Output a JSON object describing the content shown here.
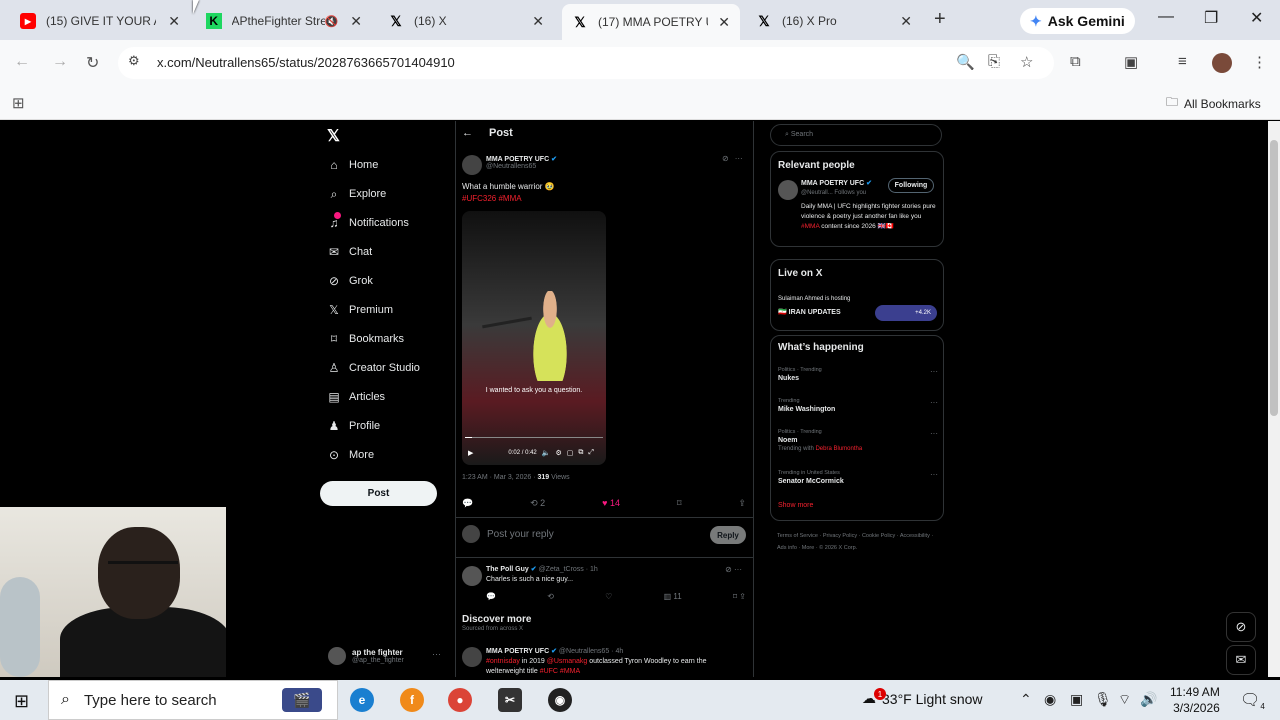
{
  "browser": {
    "tabs": [
      {
        "title": "(15) GIVE IT YOUR AL",
        "icon": "youtube-icon",
        "active": false
      },
      {
        "title": "APtheFighter Stre",
        "icon": "kick-icon",
        "active": false
      },
      {
        "title": "(16) X",
        "icon": "x-logo-icon",
        "active": false
      },
      {
        "title": "(17) MMA POETRY U",
        "icon": "x-logo-icon",
        "active": true
      },
      {
        "title": "(16) X Pro",
        "icon": "x-logo-icon",
        "active": false
      }
    ],
    "ask_gemini": "Ask Gemini",
    "url": "x.com/Neutrallens65/status/2028763665701404910",
    "all_bookmarks": "All Bookmarks"
  },
  "x": {
    "nav": [
      {
        "label": "Home",
        "icon": "home-icon"
      },
      {
        "label": "Explore",
        "icon": "search-icon"
      },
      {
        "label": "Notifications",
        "icon": "bell-icon"
      },
      {
        "label": "Chat",
        "icon": "chat-icon"
      },
      {
        "label": "Grok",
        "icon": "grok-icon"
      },
      {
        "label": "Premium",
        "icon": "premium-icon"
      },
      {
        "label": "Bookmarks",
        "icon": "bookmark-icon"
      },
      {
        "label": "Creator Studio",
        "icon": "creator-icon"
      },
      {
        "label": "Articles",
        "icon": "article-icon"
      },
      {
        "label": "Profile",
        "icon": "profile-icon"
      },
      {
        "label": "More",
        "icon": "more-icon"
      }
    ],
    "post_button": "Post",
    "me": {
      "name": "ap the fighter",
      "handle": "@ap_the_fighter"
    },
    "header": "Post",
    "post": {
      "author": "MMA POETRY UFC",
      "handle": "@Neutrallens65",
      "text": "What a humble warrior 🥹",
      "tags": "#UFC326 #MMA",
      "caption": "I wanted to ask you a question.",
      "video_time": "0:02 / 0:42",
      "video_progress": 0.05,
      "time": "1:23 AM · Mar 3, 2026 · ",
      "views": "319",
      "views_label": " Views",
      "retweets": "2",
      "likes": "14",
      "reply_placeholder": "Post your reply",
      "reply_button": "Reply"
    },
    "comment": {
      "author": "The Poll Guy",
      "handle": "@Zeta_tCross · 1h",
      "text": "Charles is such a nice guy...",
      "views": "11"
    },
    "discover": {
      "title": "Discover more",
      "subtitle": "Sourced from across X",
      "author": "MMA POETRY UFC",
      "handle": "@Neutrallens65 · 4h",
      "text_tag1": "#ontnisday",
      "text_part1": " in 2019 ",
      "text_tag2": "@Usmanakg",
      "text_part2": " outclassed Tyron Woodley to earn the welterweight title ",
      "text_tag3": "#UFC #MMA"
    },
    "search_placeholder": "Search",
    "relevant": {
      "title": "Relevant people",
      "name": "MMA POETRY UFC",
      "handle": "@Neutrall... Follows you",
      "follow": "Following",
      "bio_part1": "Daily MMA | UFC highlights fighter stories pure violence & poetry just another fan like you ",
      "bio_tag": "#MMA",
      "bio_part2": " content since 2026 🇬🇧🇨🇦"
    },
    "live": {
      "title": "Live on X",
      "host": "Sulaiman Ahmed is hosting",
      "event": "🇮🇷 IRAN UPDATES",
      "count": "+4.2K"
    },
    "happening": {
      "title": "What’s happening",
      "trends": [
        {
          "context": "Politics · Trending",
          "name": "Nukes",
          "sub": ""
        },
        {
          "context": "Trending",
          "name": "Mike Washington",
          "sub": ""
        },
        {
          "context": "Politics · Trending",
          "name": "Noem",
          "sub_prefix": "Trending with ",
          "sub_link": "Debra Blumontha"
        },
        {
          "context": "Trending in United States",
          "name": "Senator McCormick",
          "sub": ""
        }
      ],
      "show_more": "Show more"
    },
    "footer": "Terms of Service · Privacy Policy · Cookie Policy · Accessibility · Ads info · More · © 2026 X Corp."
  },
  "taskbar": {
    "search_placeholder": "Type here to search",
    "weather": "33°F  Light snow",
    "weather_badge": "1",
    "time": "11:49 AM",
    "date": "3/3/2026",
    "notif_count": "4"
  }
}
